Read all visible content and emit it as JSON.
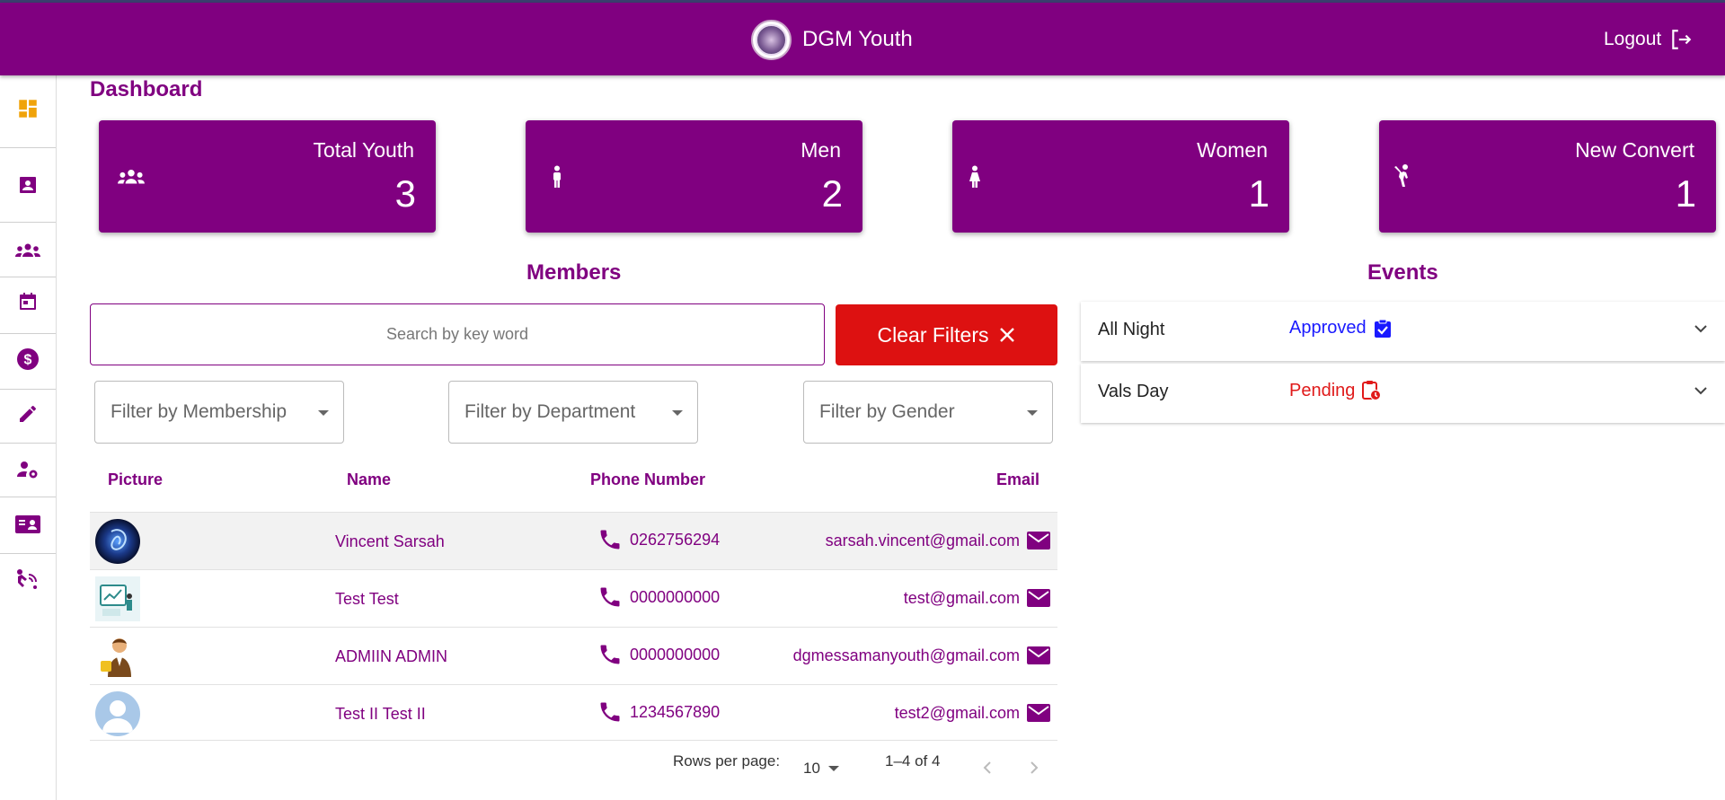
{
  "header": {
    "title": "DGM Youth",
    "logout_label": "Logout"
  },
  "sidebar": {
    "items": [
      {
        "icon": "dashboard-icon",
        "active": true
      },
      {
        "icon": "contact-card-icon"
      },
      {
        "icon": "groups-icon"
      },
      {
        "icon": "calendar-icon"
      },
      {
        "icon": "dollar-icon"
      },
      {
        "icon": "edit-pencil-icon"
      },
      {
        "icon": "user-settings-icon"
      },
      {
        "icon": "id-card-icon"
      },
      {
        "icon": "access-icon"
      }
    ]
  },
  "dashboard": {
    "title": "Dashboard",
    "cards": [
      {
        "label": "Total Youth",
        "value": "3",
        "icon": "groups-icon"
      },
      {
        "label": "Men",
        "value": "2",
        "icon": "man-icon"
      },
      {
        "label": "Women",
        "value": "1",
        "icon": "woman-icon"
      },
      {
        "label": "New Convert",
        "value": "1",
        "icon": "convert-icon"
      }
    ]
  },
  "members": {
    "title": "Members",
    "search_placeholder": "Search by key word",
    "clear_filters_label": "Clear Filters",
    "filters": {
      "membership": "Filter by Membership",
      "department": "Filter by Department",
      "gender": "Filter by Gender"
    },
    "columns": {
      "picture": "Picture",
      "name": "Name",
      "phone": "Phone Number",
      "email": "Email"
    },
    "rows": [
      {
        "name": "Vincent Sarsah",
        "phone": "0262756294",
        "email": "sarsah.vincent@gmail.com"
      },
      {
        "name": "Test Test",
        "phone": "0000000000",
        "email": "test@gmail.com"
      },
      {
        "name": "ADMIIN ADMIN",
        "phone": "0000000000",
        "email": "dgmessamanyouth@gmail.com"
      },
      {
        "name": "Test II Test II",
        "phone": "1234567890",
        "email": "test2@gmail.com"
      }
    ],
    "pagination": {
      "rows_per_page_label": "Rows per page:",
      "rows_per_page": "10",
      "range": "1–4 of 4"
    }
  },
  "events": {
    "title": "Events",
    "items": [
      {
        "name": "All Night",
        "status": "Approved",
        "status_color": "#1a1aff",
        "icon": "clipboard-check-icon"
      },
      {
        "name": "Vals Day",
        "status": "Pending",
        "status_color": "#e01a1a",
        "icon": "clipboard-clock-icon"
      }
    ]
  },
  "colors": {
    "primary": "#800080",
    "danger": "#dd1111",
    "approved": "#1a1aff",
    "pending": "#e01a1a",
    "dashboard_icon": "#f0a30a"
  }
}
